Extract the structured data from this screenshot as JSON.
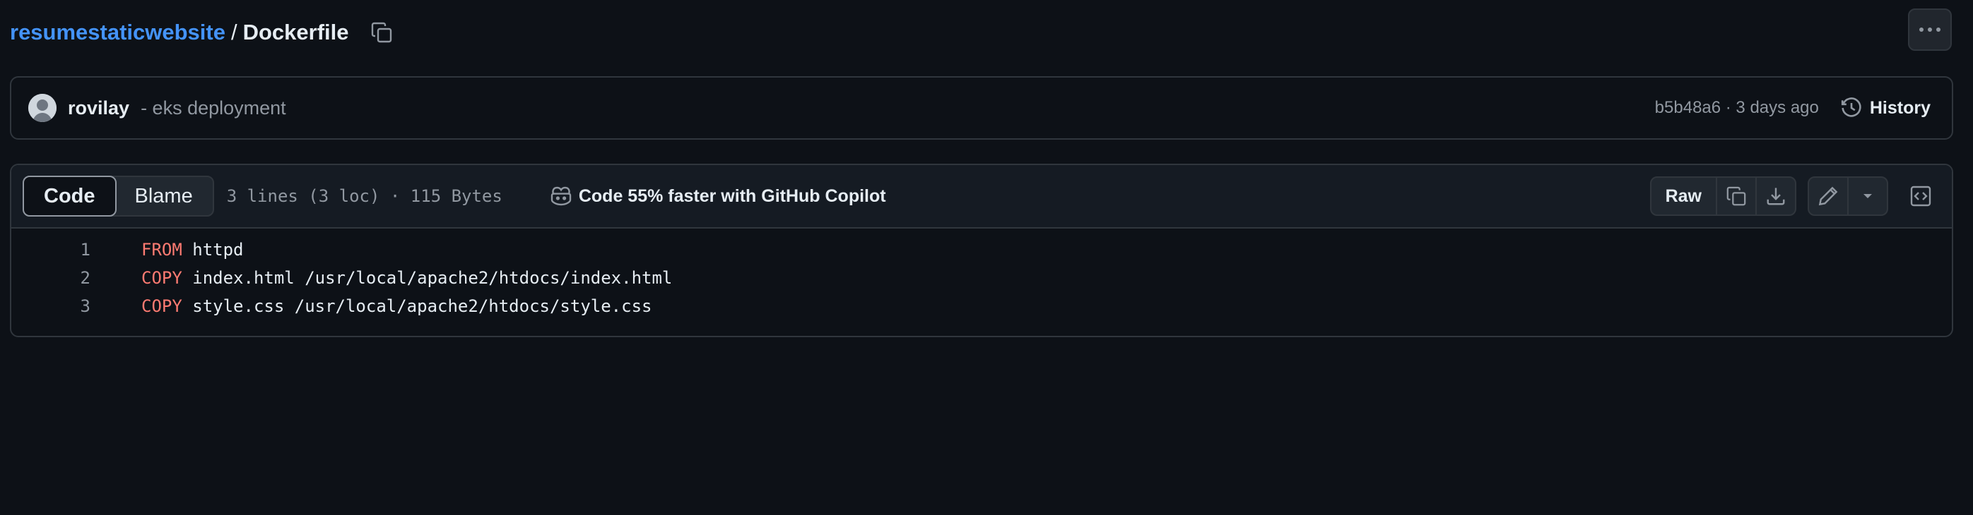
{
  "breadcrumb": {
    "repo": "resumestaticwebsite",
    "separator": "/",
    "file": "Dockerfile"
  },
  "commit": {
    "author": "rovilay",
    "message": "- eks deployment",
    "sha_time": "b5b48a6 · 3 days ago",
    "history_label": "History"
  },
  "file_header": {
    "tabs": [
      {
        "label": "Code",
        "active": true
      },
      {
        "label": "Blame",
        "active": false
      }
    ],
    "meta": "3 lines (3 loc) · 115 Bytes",
    "copilot_label": "Code 55% faster with GitHub Copilot",
    "raw_label": "Raw"
  },
  "code": {
    "lines": [
      {
        "num": "1",
        "keyword": "FROM",
        "rest": " httpd"
      },
      {
        "num": "2",
        "keyword": "COPY",
        "rest": " index.html /usr/local/apache2/htdocs/index.html"
      },
      {
        "num": "3",
        "keyword": "COPY",
        "rest": " style.css /usr/local/apache2/htdocs/style.css"
      }
    ]
  },
  "colors": {
    "background": "#0d1117",
    "link": "#4493f8",
    "keyword": "#ff7b72",
    "muted": "#9198a1",
    "border": "#30363d"
  },
  "icons": [
    "copy-icon",
    "kebab-icon",
    "history-icon",
    "copilot-icon",
    "download-icon",
    "pencil-icon",
    "triangle-down-icon",
    "code-square-icon"
  ]
}
